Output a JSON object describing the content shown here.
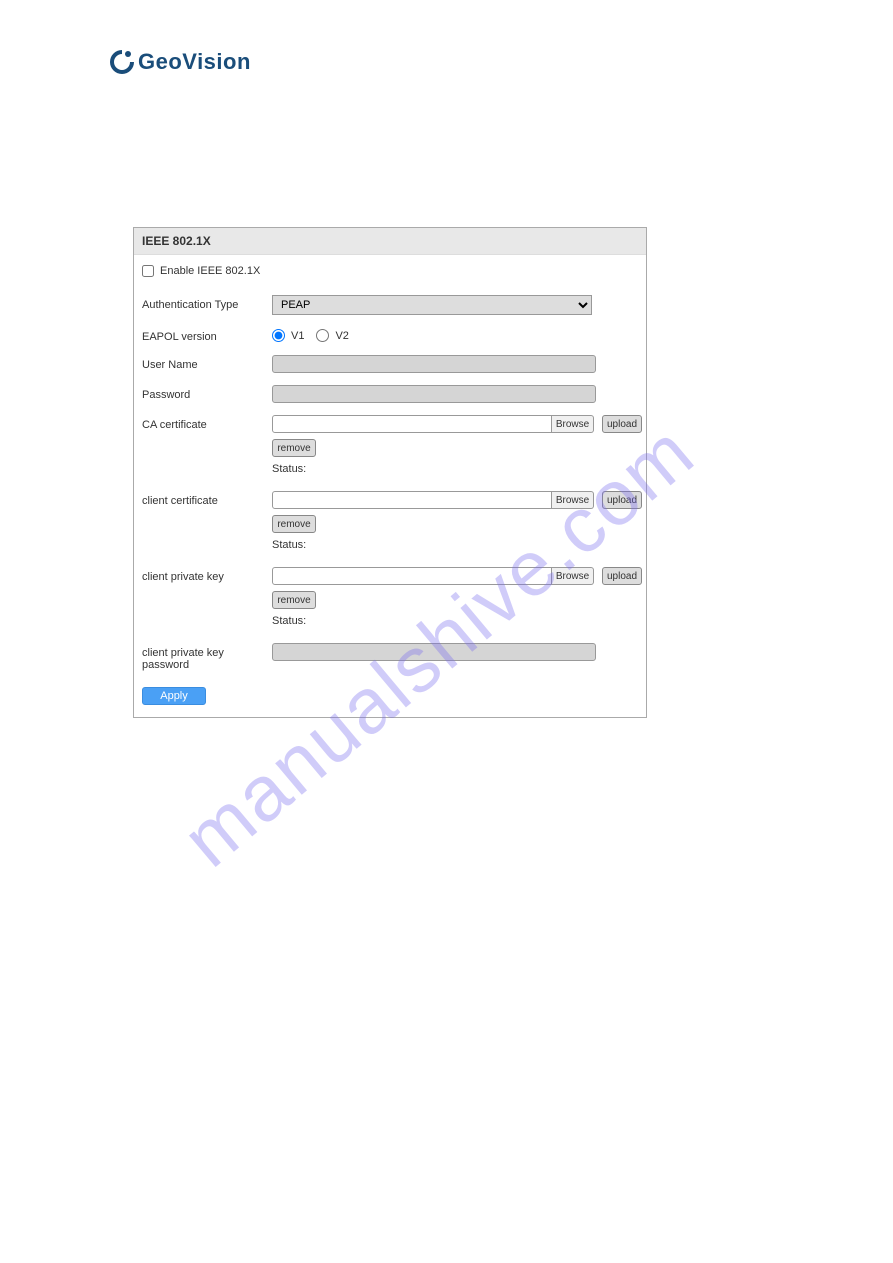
{
  "logo": {
    "brand": "GeoVision"
  },
  "panel": {
    "title": "IEEE 802.1X",
    "enable_label": "Enable IEEE 802.1X",
    "auth_type_label": "Authentication Type",
    "auth_type_value": "PEAP",
    "eapol_label": "EAPOL version",
    "eapol_v1": "V1",
    "eapol_v2": "V2",
    "username_label": "User Name",
    "password_label": "Password",
    "ca_cert_label": "CA certificate",
    "client_cert_label": "client certificate",
    "client_key_label": "client private key",
    "client_key_pw_label": "client private key password",
    "browse_label": "Browse",
    "upload_label": "upload",
    "remove_label": "remove",
    "status_label": "Status:",
    "apply_label": "Apply"
  },
  "watermark": "manualshive.com"
}
